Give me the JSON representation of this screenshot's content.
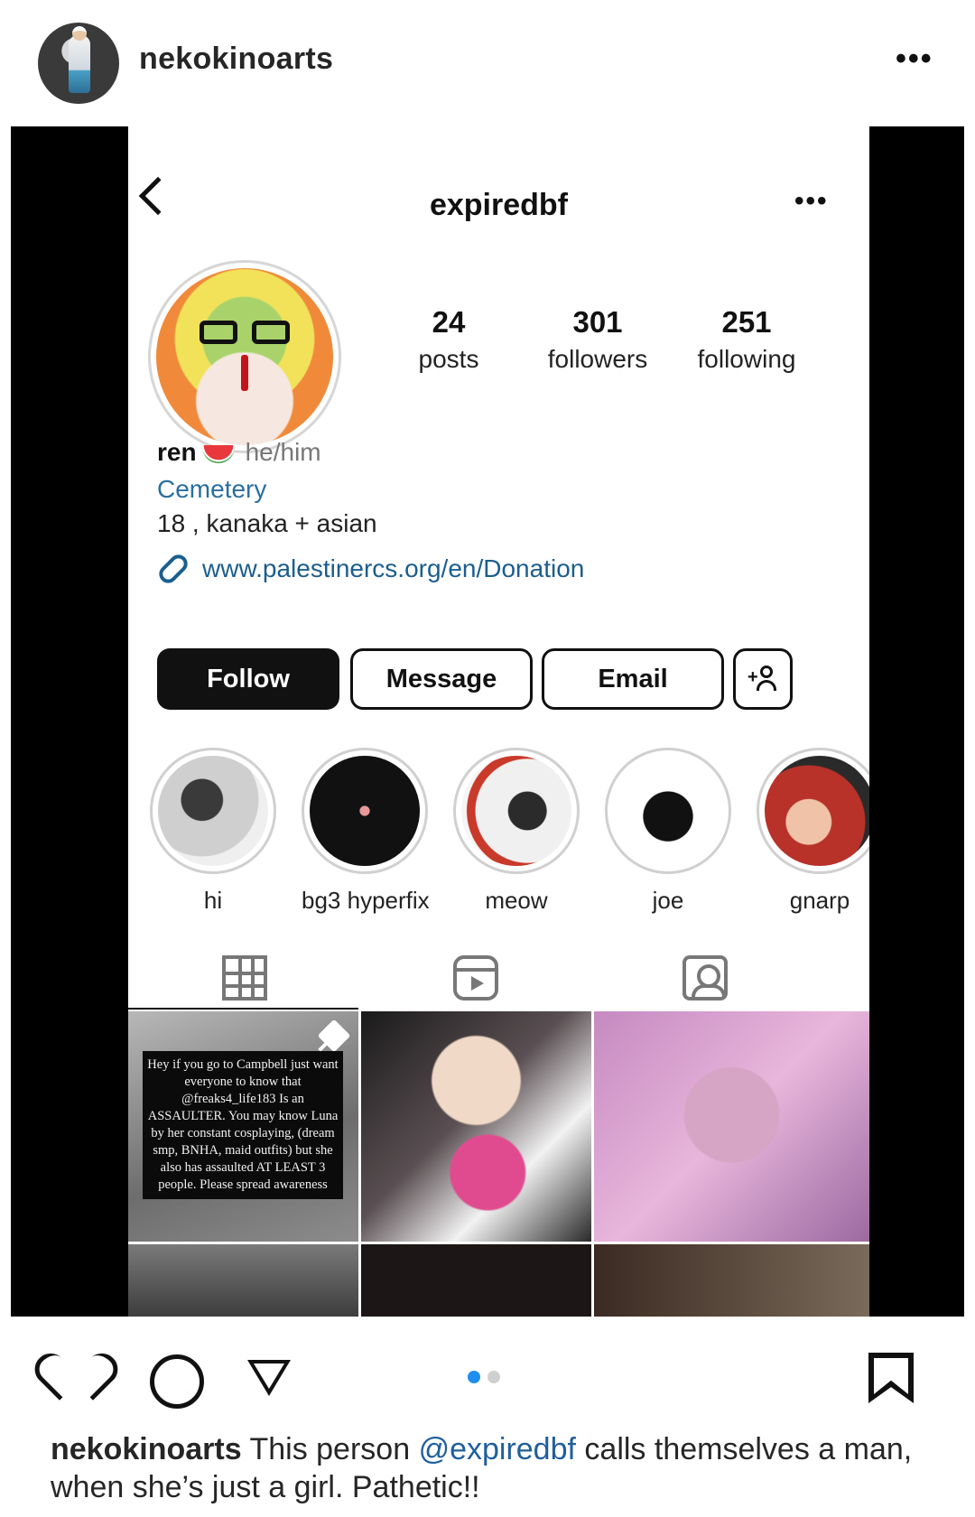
{
  "post": {
    "username": "nekokinoarts",
    "more": "•••",
    "caption": {
      "author": "nekokinoarts",
      "text_before": "This person",
      "mention": "@expiredbf",
      "text_after": "calls themselves a man, when she’s just a girl. Pathetic!!"
    },
    "carousel": {
      "count": 2,
      "active": 0
    },
    "colors": {
      "accent": "#1f8ef1",
      "dot_inactive": "#d0d0d0"
    }
  },
  "screenshot": {
    "profile_username": "expiredbf",
    "more": "•••",
    "stats": [
      {
        "num": "24",
        "label": "posts"
      },
      {
        "num": "301",
        "label": "followers"
      },
      {
        "num": "251",
        "label": "following"
      }
    ],
    "name": "ren",
    "pronouns": "he/him",
    "category": "Cemetery",
    "bio": "18 , kanaka + asian",
    "link": "www.palestinercs.org/en/Donation",
    "buttons": {
      "follow": "Follow",
      "message": "Message",
      "email": "Email"
    },
    "highlights": [
      {
        "label": "hi"
      },
      {
        "label": "bg3 hyperfix"
      },
      {
        "label": "meow"
      },
      {
        "label": "joe"
      },
      {
        "label": "gnarp"
      }
    ],
    "pinned_post_text": "Hey if you go to Campbell just want everyone to know that @freaks4_life183 Is an ASSAULTER. You may know Luna by her constant cosplaying, (dream smp, BNHA, maid outfits) but she also has assaulted AT LEAST 3 people. Please spread awareness"
  }
}
